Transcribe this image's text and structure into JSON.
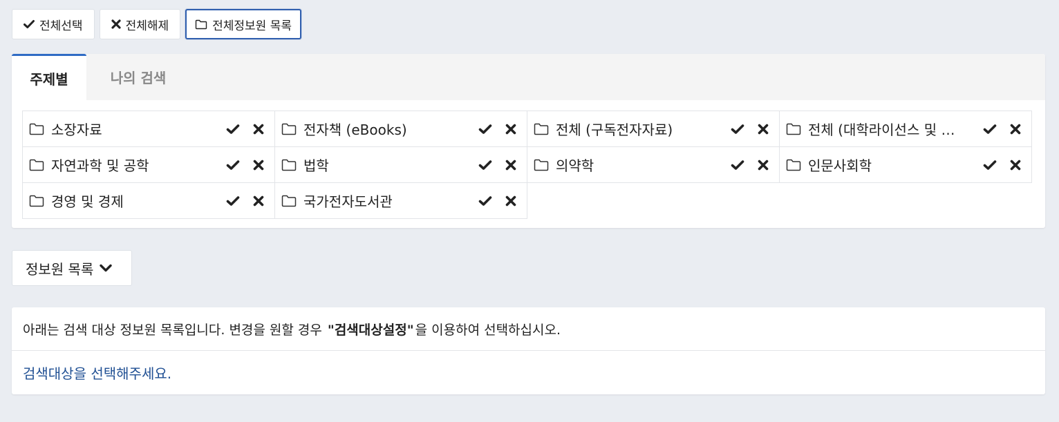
{
  "toolbar": {
    "select_all": "전체선택",
    "deselect_all": "전체해제",
    "all_sources": "전체정보원 목록"
  },
  "tabs": [
    {
      "label": "주제별",
      "active": true
    },
    {
      "label": "나의 검색",
      "active": false
    }
  ],
  "categories": [
    "소장자료",
    "전자책 (eBooks)",
    "전체 (구독전자자료)",
    "전체 (대학라이선스 및 …",
    "자연과학 및 공학",
    "법학",
    "의약학",
    "인문사회학",
    "경영 및 경제",
    "국가전자도서관"
  ],
  "source_list_toggle": "정보원 목록",
  "info": {
    "text_before": "아래는 검색 대상 정보원 목록입니다. 변경을 원할 경우 ",
    "text_bold": "\"검색대상설정\"",
    "text_after": "을 이용하여 선택하십시오.",
    "empty_message": "검색대상을 선택해주세요."
  },
  "colors": {
    "background": "#eaedf2",
    "accent": "#2f6bc4",
    "link": "#1f4f93"
  }
}
